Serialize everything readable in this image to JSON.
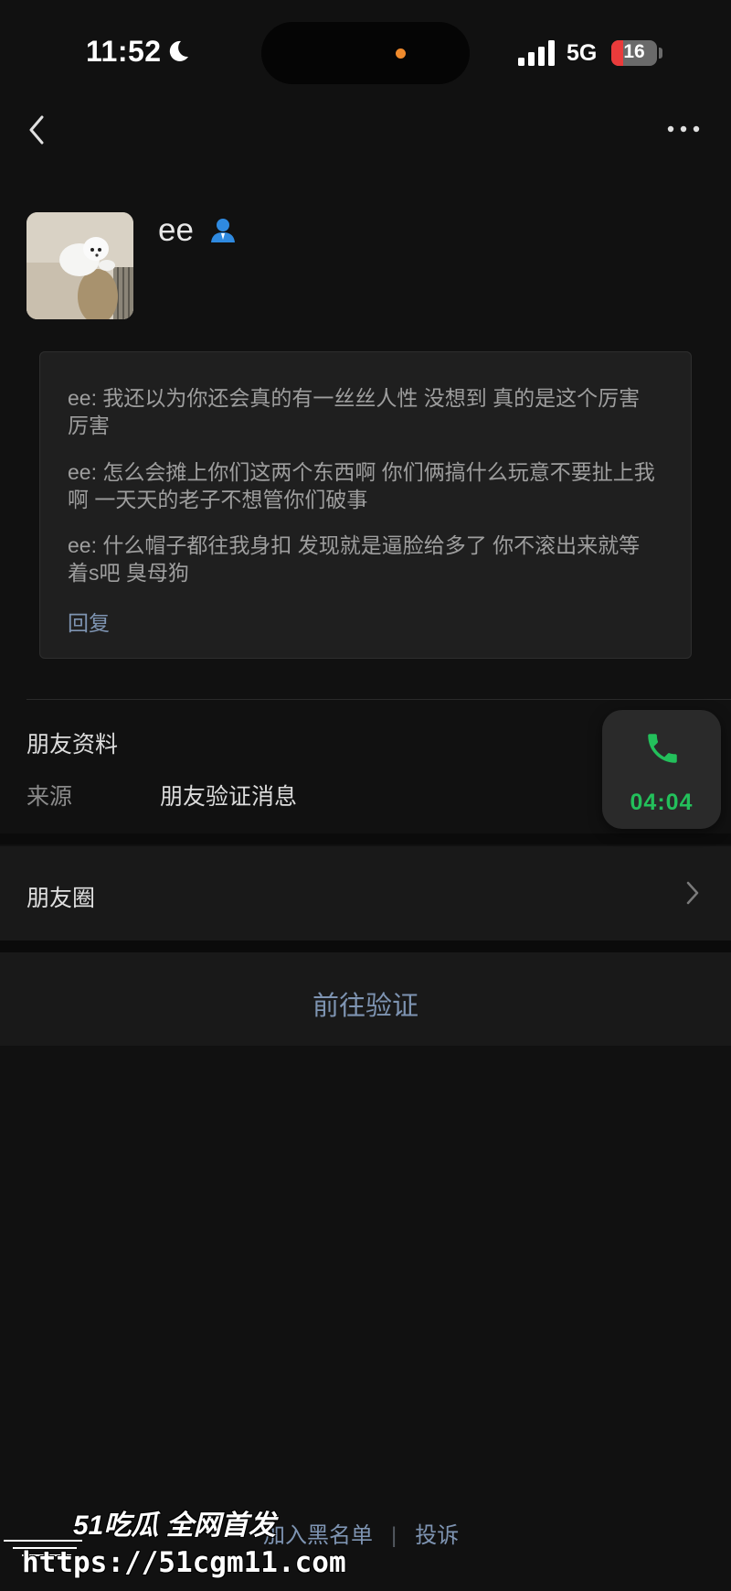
{
  "status_bar": {
    "time": "11:52",
    "network": "5G",
    "battery": "16",
    "icons": [
      "moon-icon",
      "signal-icon",
      "battery-icon"
    ],
    "colors": {
      "battery_low": "#ea3b3b",
      "island_dot": "#f08a2c"
    }
  },
  "nav": {
    "back_icon": "chevron-left-icon",
    "more_icon": "more-icon"
  },
  "profile": {
    "name": "ee",
    "badge_icon": "person-icon"
  },
  "messages": [
    {
      "text": "ee: 我还以为你还会真的有一丝丝人性 没想到 真的是这个厉害厉害"
    },
    {
      "text": "ee: 怎么会摊上你们这两个东西啊 你们俩搞什么玩意不要扯上我啊 一天天的老子不想管你们破事"
    },
    {
      "text": "ee: 什么帽子都往我身扣 发现就是逼脸给多了 你不滚出来就等着s吧 臭母狗"
    }
  ],
  "reply_label": "回复",
  "info": {
    "section_title": "朋友资料",
    "source_label": "来源",
    "source_value": "朋友验证消息"
  },
  "moments_label": "朋友圈",
  "verify_button": "前往验证",
  "call": {
    "duration": "04:04",
    "color": "#23c05b"
  },
  "bottom": {
    "blacklist": "加入黑名单",
    "separator": "|",
    "report": "投诉"
  },
  "watermark": {
    "line1": "51吃瓜 全网首发",
    "line2": "https://51cgm11.com"
  },
  "colors": {
    "link": "#7e94b2",
    "background": "#111111"
  }
}
